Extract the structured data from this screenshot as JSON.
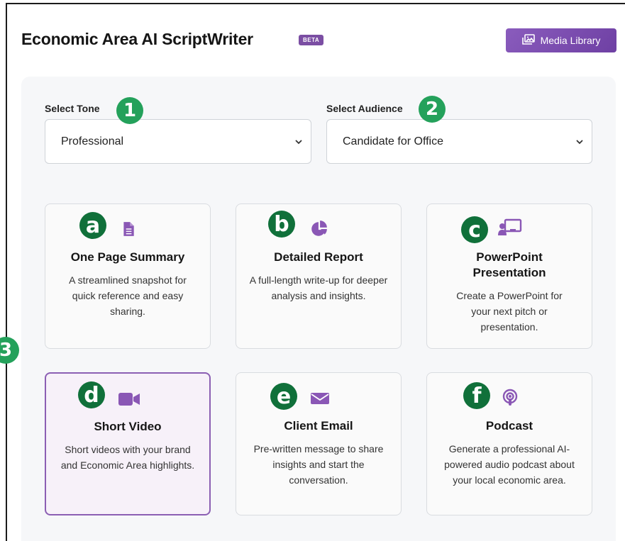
{
  "header": {
    "title": "Economic Area AI ScriptWriter",
    "badge": "BETA",
    "media_button": "Media Library"
  },
  "controls": {
    "tone": {
      "label": "Select Tone",
      "value": "Professional"
    },
    "audience": {
      "label": "Select Audience",
      "value": "Candidate for Office"
    }
  },
  "markers": {
    "tone": "1",
    "audience": "2",
    "cards": "3"
  },
  "cards": [
    {
      "marker": "a",
      "icon": "document-icon",
      "title": "One Page Summary",
      "desc": "A streamlined snapshot for quick reference and easy sharing.",
      "selected": false
    },
    {
      "marker": "b",
      "icon": "pie-chart-icon",
      "title": "Detailed Report",
      "desc": "A full-length write-up for deeper analysis and insights.",
      "selected": false
    },
    {
      "marker": "c",
      "icon": "presentation-icon",
      "title": "PowerPoint Presentation",
      "desc": "Create a PowerPoint for your next pitch or presentation.",
      "selected": false
    },
    {
      "marker": "d",
      "icon": "video-icon",
      "title": "Short Video",
      "desc": "Short videos with your brand and Economic Area highlights.",
      "selected": true
    },
    {
      "marker": "e",
      "icon": "envelope-icon",
      "title": "Client Email",
      "desc": "Pre-written message to share insights and start the conversation.",
      "selected": false
    },
    {
      "marker": "f",
      "icon": "podcast-icon",
      "title": "Podcast",
      "desc": "Generate a professional AI-powered audio podcast about your local economic area.",
      "selected": false
    }
  ],
  "colors": {
    "accent": "#7b4ea3",
    "marker": "#198a4e",
    "panel": "#f6f7f9"
  }
}
